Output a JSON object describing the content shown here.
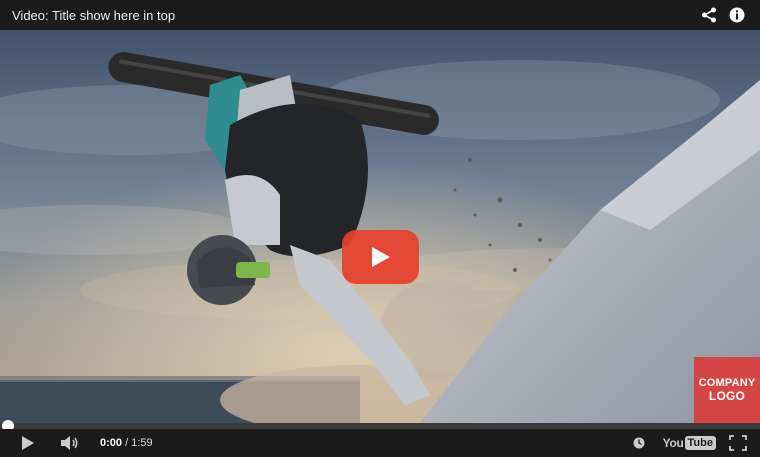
{
  "player": {
    "title": "Video: Title show here in top",
    "current_time": "0:00",
    "separator": "/",
    "duration": "1:59",
    "progress_fraction": 0.0,
    "play_button_color": "#e8412e",
    "progress_color": "#cc181e"
  },
  "branding": {
    "logo_line1": "COMPANY",
    "logo_line2": "LOGO",
    "logo_color": "#d64545",
    "youtube_you": "You",
    "youtube_tube": "Tube"
  },
  "icons": {
    "share": "share-icon",
    "info": "info-icon",
    "play": "play-icon",
    "volume": "volume-icon",
    "watch_later": "clock-icon",
    "fullscreen": "fullscreen-icon"
  }
}
